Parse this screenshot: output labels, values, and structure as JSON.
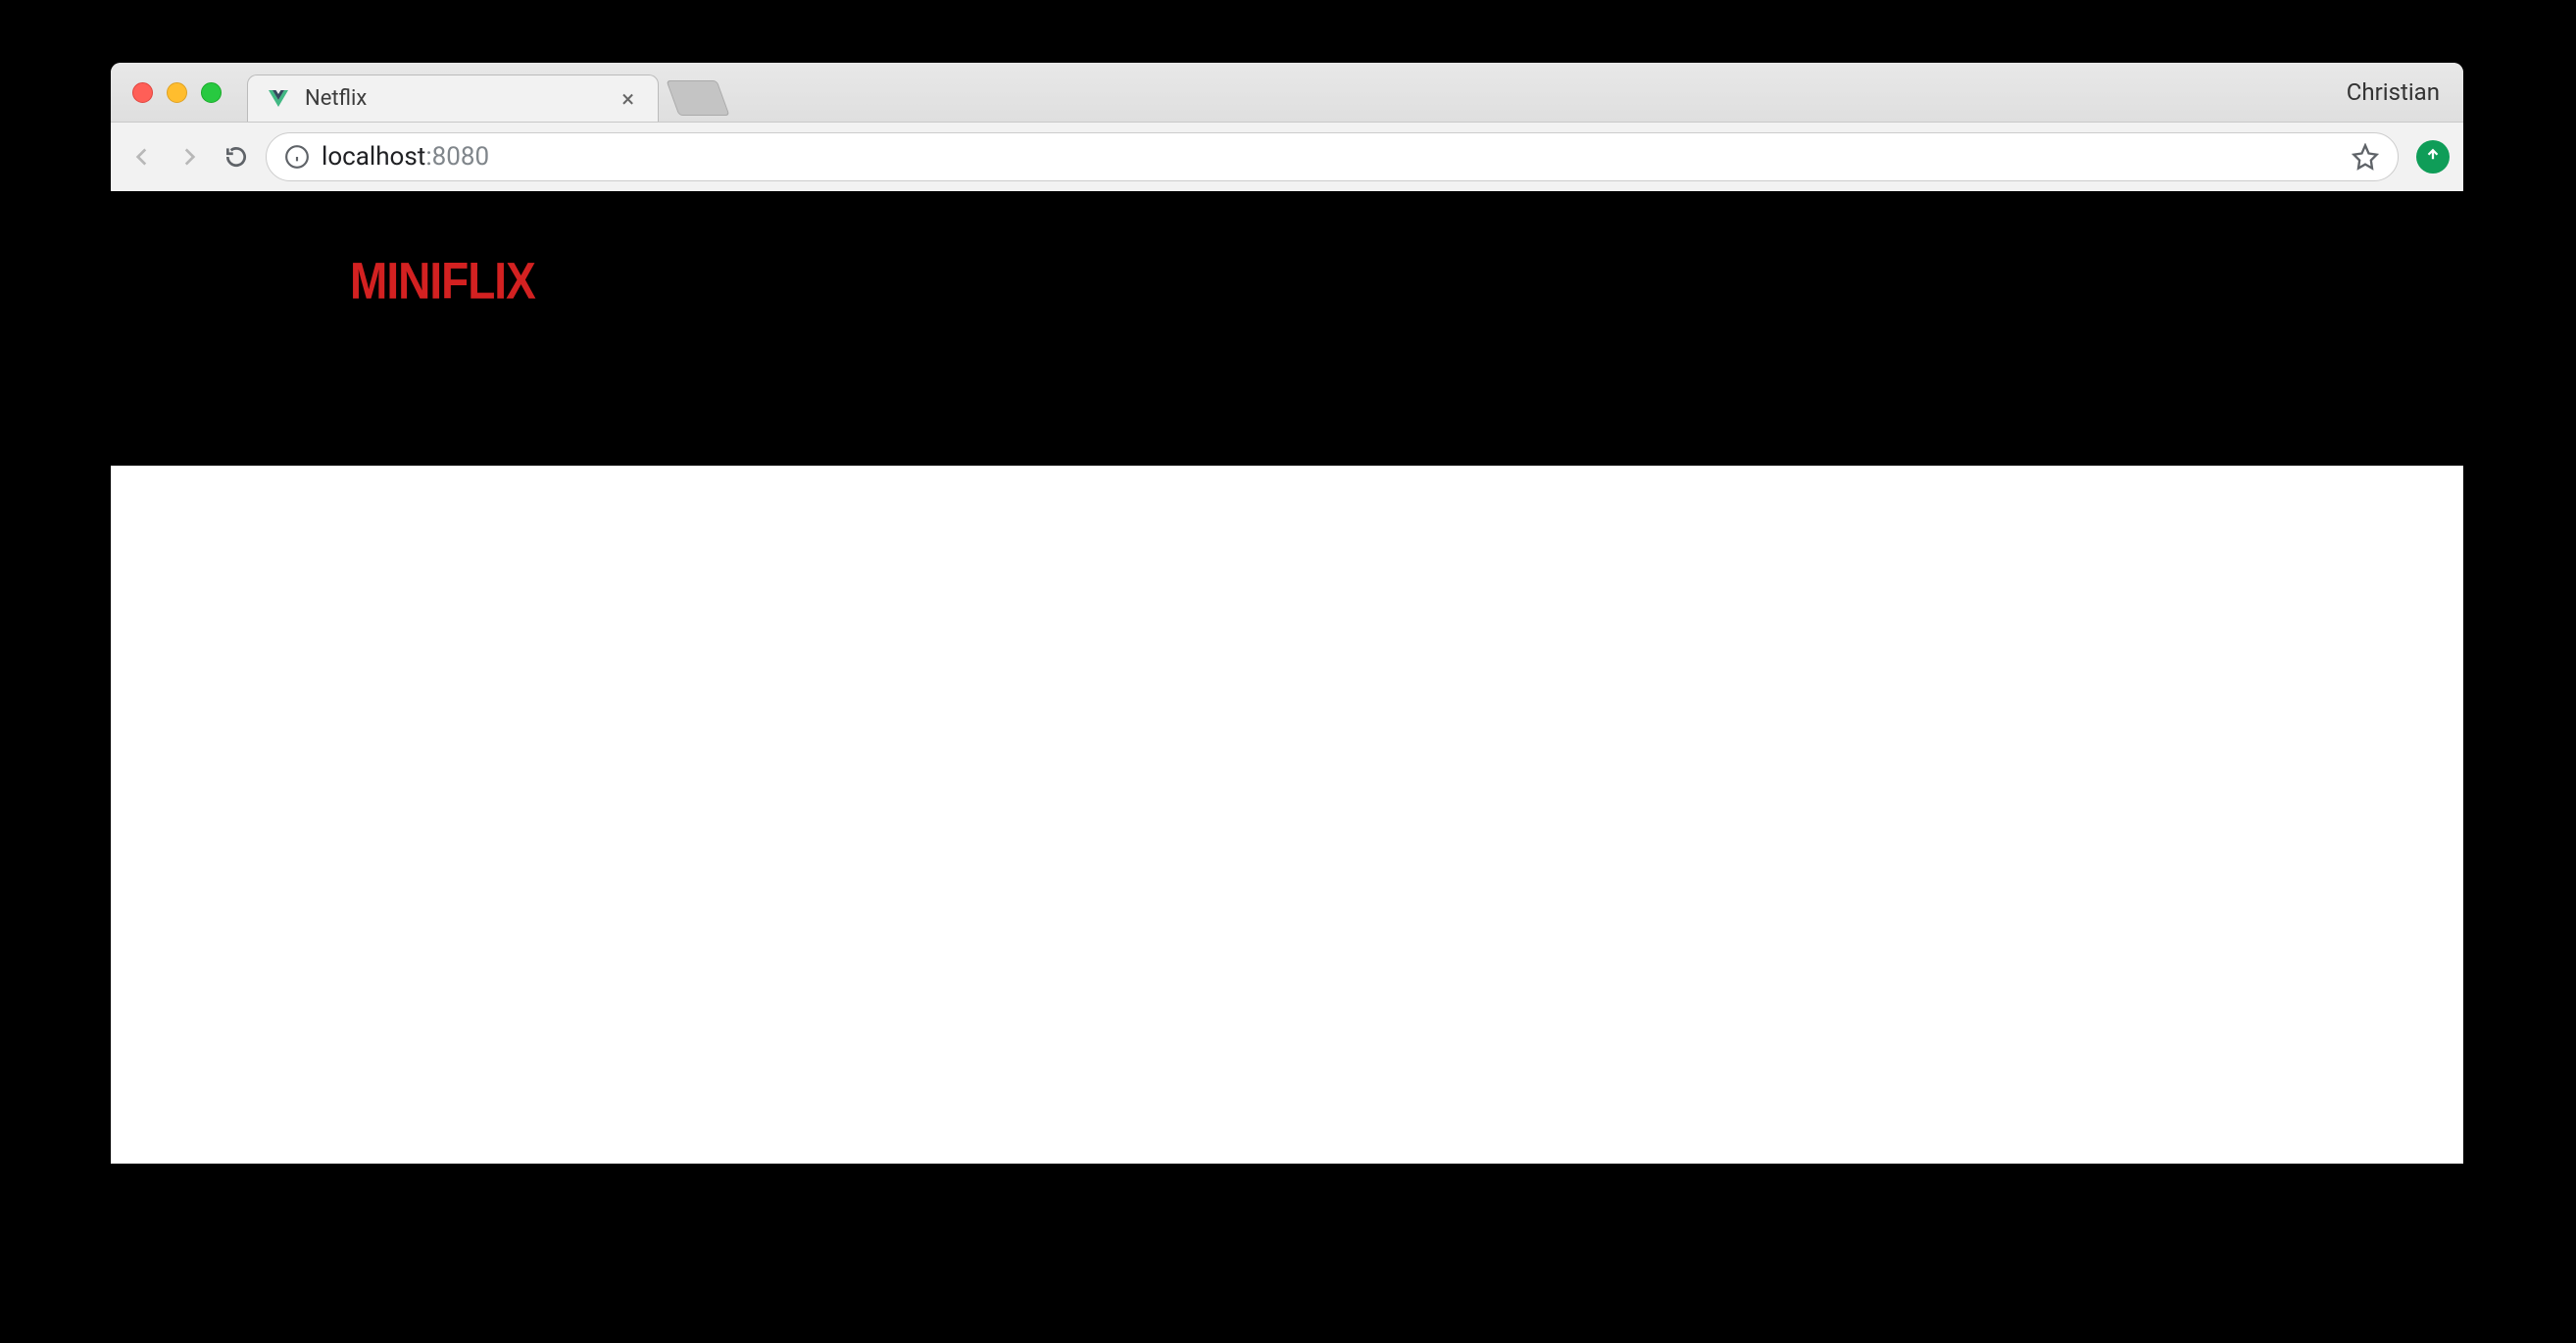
{
  "browser": {
    "tab_title": "Netflix",
    "profile_name": "Christian",
    "url_host": "localhost",
    "url_port": ":8080"
  },
  "page": {
    "logo_text": "MINIFLIX"
  }
}
